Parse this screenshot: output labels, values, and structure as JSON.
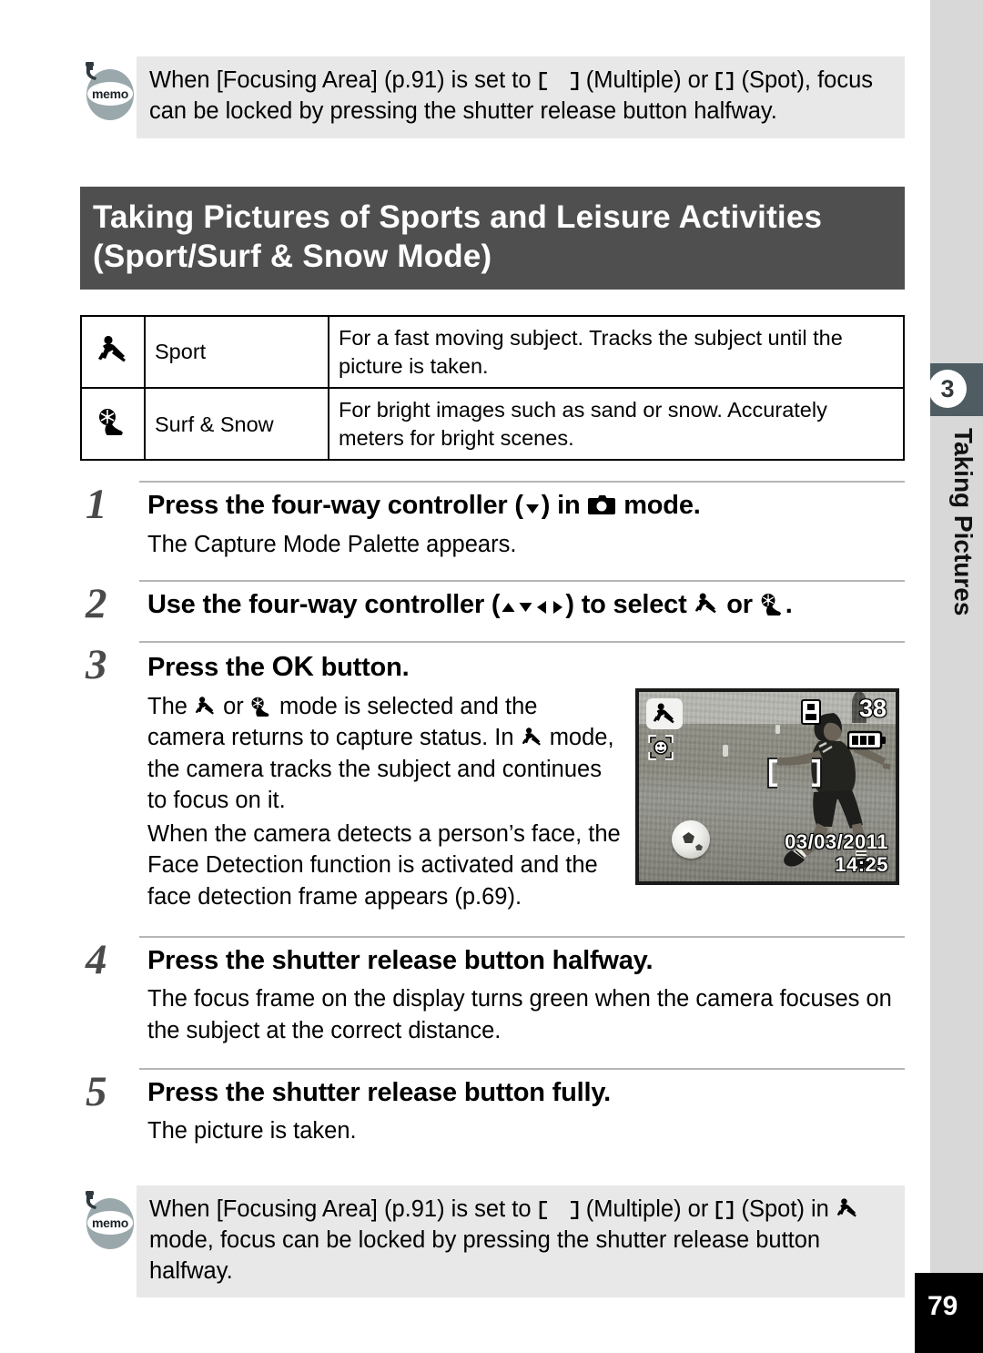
{
  "memo_top": {
    "icon_label": "memo",
    "text_part1": "When [Focusing Area] (p.91) is set to ",
    "text_part2": " (Multiple) or ",
    "text_part3": " (Spot), focus can be locked by pressing the shutter release button halfway."
  },
  "section": {
    "title_line1": "Taking Pictures of Sports and Leisure Activities",
    "title_line2": "(Sport/Surf & Snow Mode)"
  },
  "mode_table": {
    "rows": [
      {
        "icon": "sport-icon",
        "name": "Sport",
        "description": "For a fast moving subject. Tracks the subject until the picture is taken."
      },
      {
        "icon": "surf-snow-icon",
        "name": "Surf & Snow",
        "description": "For bright images such as sand or snow. Accurately meters for bright scenes."
      }
    ]
  },
  "steps": [
    {
      "number": "1",
      "head_part1": "Press the four-way controller (",
      "head_part2": ") in ",
      "head_part3": " mode.",
      "body": "The Capture Mode Palette appears."
    },
    {
      "number": "2",
      "head_part1": "Use the four-way controller (",
      "head_part2": ") to select ",
      "head_part3": " or ",
      "head_part4": "."
    },
    {
      "number": "3",
      "head_part1": "Press the ",
      "head_ok": "OK",
      "head_part2": " button.",
      "body_line1_a": "The ",
      "body_line1_b": " or ",
      "body_line1_c": " mode is selected and the camera returns to capture status. In ",
      "body_line1_d": " mode, the camera tracks the subject and continues to focus on it.",
      "body_line2": "When the camera detects a person’s face, the Face Detection function is activated and the face detection frame appears (p.69)."
    },
    {
      "number": "4",
      "head": "Press the shutter release button halfway.",
      "body": "The focus frame on the display turns green when the camera focuses on the subject at the correct distance."
    },
    {
      "number": "5",
      "head": "Press the shutter release button fully.",
      "body": "The picture is taken."
    }
  ],
  "lcd": {
    "frames_remaining": "38",
    "date": "03/03/2011",
    "time": "14:25",
    "mode_icon": "sport-icon",
    "face_icon": "face-detection-icon",
    "card_icon": "sd-card-icon",
    "battery_icon": "battery-full-icon",
    "focus_icon": "focus-frame-icon"
  },
  "memo_bottom": {
    "icon_label": "memo",
    "text_part1": "When [Focusing Area] (p.91) is set to ",
    "text_part2": " (Multiple) or ",
    "text_part3": " (Spot) in ",
    "text_part4": " mode, focus can be locked by pressing the shutter release button halfway."
  },
  "chapter_tab": {
    "number": "3",
    "label": "Taking Pictures"
  },
  "page_number": "79",
  "colors": {
    "title_bar_bg": "#4f4f4f",
    "memo_bg": "#e8e8e8",
    "tab_bg": "#4f5d63",
    "side_strip_bg": "#d8d8d8",
    "step_number": "#4a4a4a"
  }
}
